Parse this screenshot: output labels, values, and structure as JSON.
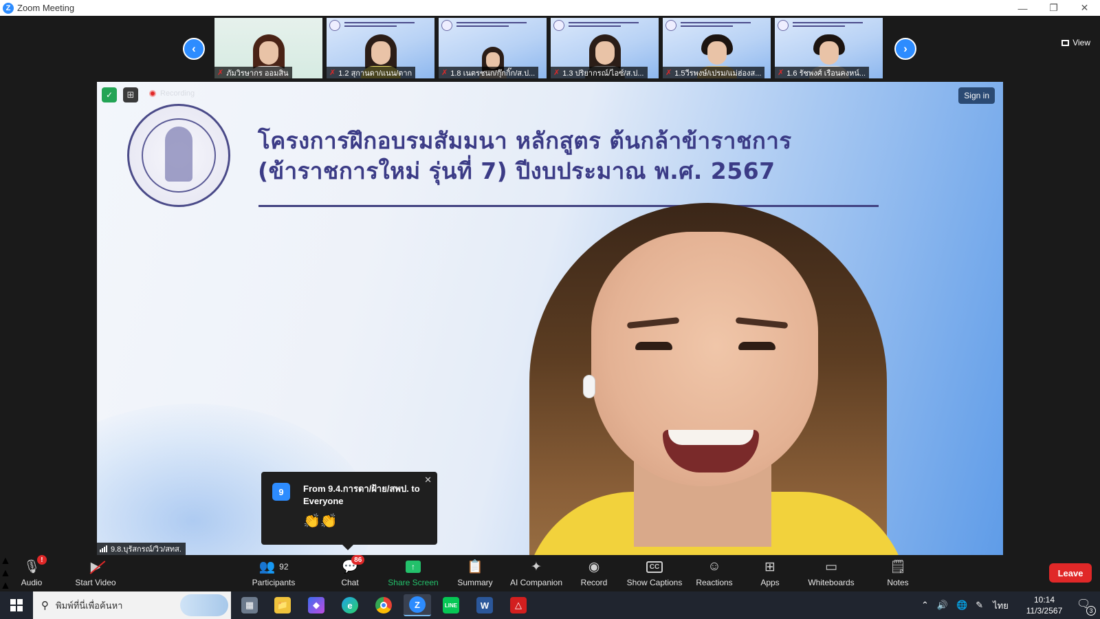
{
  "window": {
    "title": "Zoom Meeting",
    "app_icon": "zoom-logo-icon",
    "controls": [
      "minimize-icon",
      "restore-icon",
      "close-icon"
    ]
  },
  "gallery": {
    "view_label": "View",
    "participants": [
      {
        "name": "ภัมวิรษากร ออมสิน"
      },
      {
        "name": "1.2 สุกานดา/แนน/ตาก"
      },
      {
        "name": "1.8 เนตรชนก/กุ๊กกิ๊ก/ส.ป..."
      },
      {
        "name": "1.3 ปริยากรณ์/ไอซ์/ส.ป..."
      },
      {
        "name": "1.5วีรพงษ์/เปรม/แม่ฮ่องส..."
      },
      {
        "name": "1.6 รัชพงศ์ เรือนคงหน์..."
      }
    ],
    "prev_icon": "chevron-left-icon",
    "next_icon": "chevron-right-icon"
  },
  "main_video": {
    "recording_label": "Recording",
    "sign_in_label": "Sign in",
    "slide_title_line1": "โครงการฝึกอบรมสัมมนา หลักสูตร ต้นกล้าข้าราชการ",
    "slide_title_line2": "(ข้าราชการใหม่ รุ่นที่ 7) ปีงบประมาณ พ.ศ. 2567",
    "speaker_name": "9.8.บุรัสกรณ์/วิว/สทส."
  },
  "chat_toast": {
    "count": "9",
    "from": "From 9.4.การดา/ฝ้าย/สพป. to Everyone",
    "message": "👏👏"
  },
  "toolbar": {
    "audio": "Audio",
    "start_video": "Start Video",
    "participants": "Participants",
    "participants_count": "92",
    "chat": "Chat",
    "chat_badge": "86",
    "share_screen": "Share Screen",
    "summary": "Summary",
    "ai_companion": "AI Companion",
    "record": "Record",
    "show_captions": "Show Captions",
    "reactions": "Reactions",
    "apps": "Apps",
    "whiteboards": "Whiteboards",
    "notes": "Notes",
    "leave": "Leave",
    "audio_alert": "!",
    "captions_icon_text": "CC"
  },
  "taskbar": {
    "search_placeholder": "พิมพ์ที่นี่เพื่อค้นหา",
    "language": "ไทย",
    "time": "10:14",
    "date": "11/3/2567",
    "notification_count": "3",
    "word_letter": "W",
    "zoom_letter": "Z",
    "line_label": "LINE"
  },
  "colors": {
    "zoom_blue": "#2d8cff",
    "share_green": "#23c16b",
    "leave_red": "#e02828",
    "slide_title": "#3b3b86"
  }
}
